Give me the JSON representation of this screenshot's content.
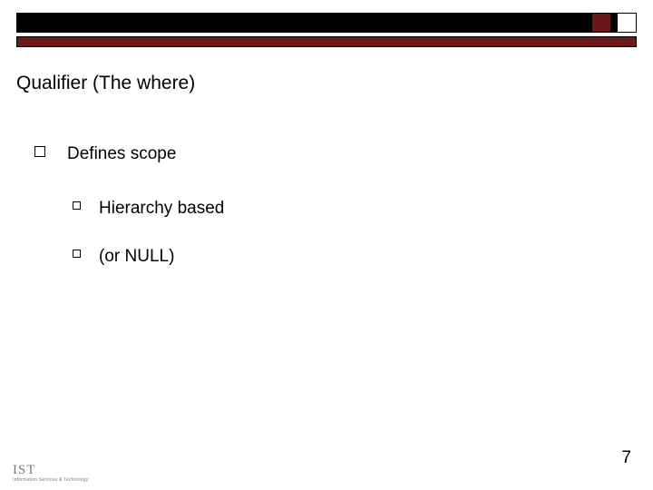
{
  "slide": {
    "title": "Qualifier (The where)",
    "bullets": {
      "main": "Defines scope",
      "sub": [
        "Hierarchy based",
        "(or NULL)"
      ]
    },
    "page_number": "7",
    "footer": {
      "logo_text": "IST",
      "logo_sub": "Information Services & Technology"
    }
  }
}
